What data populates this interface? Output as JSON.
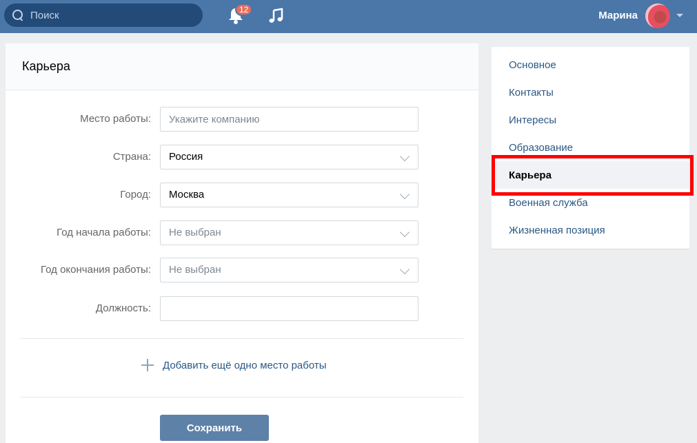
{
  "header": {
    "search_placeholder": "Поиск",
    "notifications_count": "12",
    "user_name": "Марина",
    "colors": {
      "bar": "#4a76a8",
      "search_bg": "#224b7a",
      "badge": "#e56e5c"
    },
    "icons": [
      "search-icon",
      "bell-icon",
      "music-icon",
      "chevron-down-icon"
    ]
  },
  "main": {
    "title": "Карьера",
    "fields": [
      {
        "label": "Место работы:",
        "placeholder": "Укажите компанию",
        "value": ""
      },
      {
        "label": "Страна:",
        "value": "Россия"
      },
      {
        "label": "Город:",
        "value": "Москва"
      },
      {
        "label": "Год начала работы:",
        "value": "Не выбран"
      },
      {
        "label": "Год окончания работы:",
        "value": "Не выбран"
      },
      {
        "label": "Должность:",
        "value": ""
      }
    ],
    "add_more_label": "Добавить ещё одно место работы",
    "save_label": "Сохранить"
  },
  "side_menu": {
    "items": [
      {
        "label": "Основное"
      },
      {
        "label": "Контакты"
      },
      {
        "label": "Интересы"
      },
      {
        "label": "Образование"
      },
      {
        "label": "Карьера",
        "active": true
      },
      {
        "label": "Военная служба"
      },
      {
        "label": "Жизненная позиция"
      }
    ],
    "highlight_color": "#ff0000"
  }
}
